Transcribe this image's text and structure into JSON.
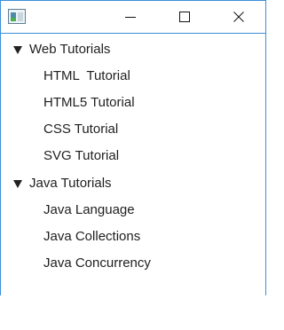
{
  "window": {
    "controls": {
      "minimize_icon": "minimize-icon",
      "maximize_icon": "maximize-icon",
      "close_icon": "close-icon"
    }
  },
  "tree": {
    "nodes": [
      {
        "label": "Web Tutorials",
        "expanded": true,
        "children": [
          "HTML  Tutorial",
          "HTML5 Tutorial",
          "CSS Tutorial",
          "SVG Tutorial"
        ]
      },
      {
        "label": "Java Tutorials",
        "expanded": true,
        "children": [
          "Java Language",
          "Java Collections",
          "Java Concurrency"
        ]
      }
    ]
  },
  "colors": {
    "window_border": "#3c8fd8",
    "text": "#1f1f1f",
    "background": "#ffffff"
  }
}
